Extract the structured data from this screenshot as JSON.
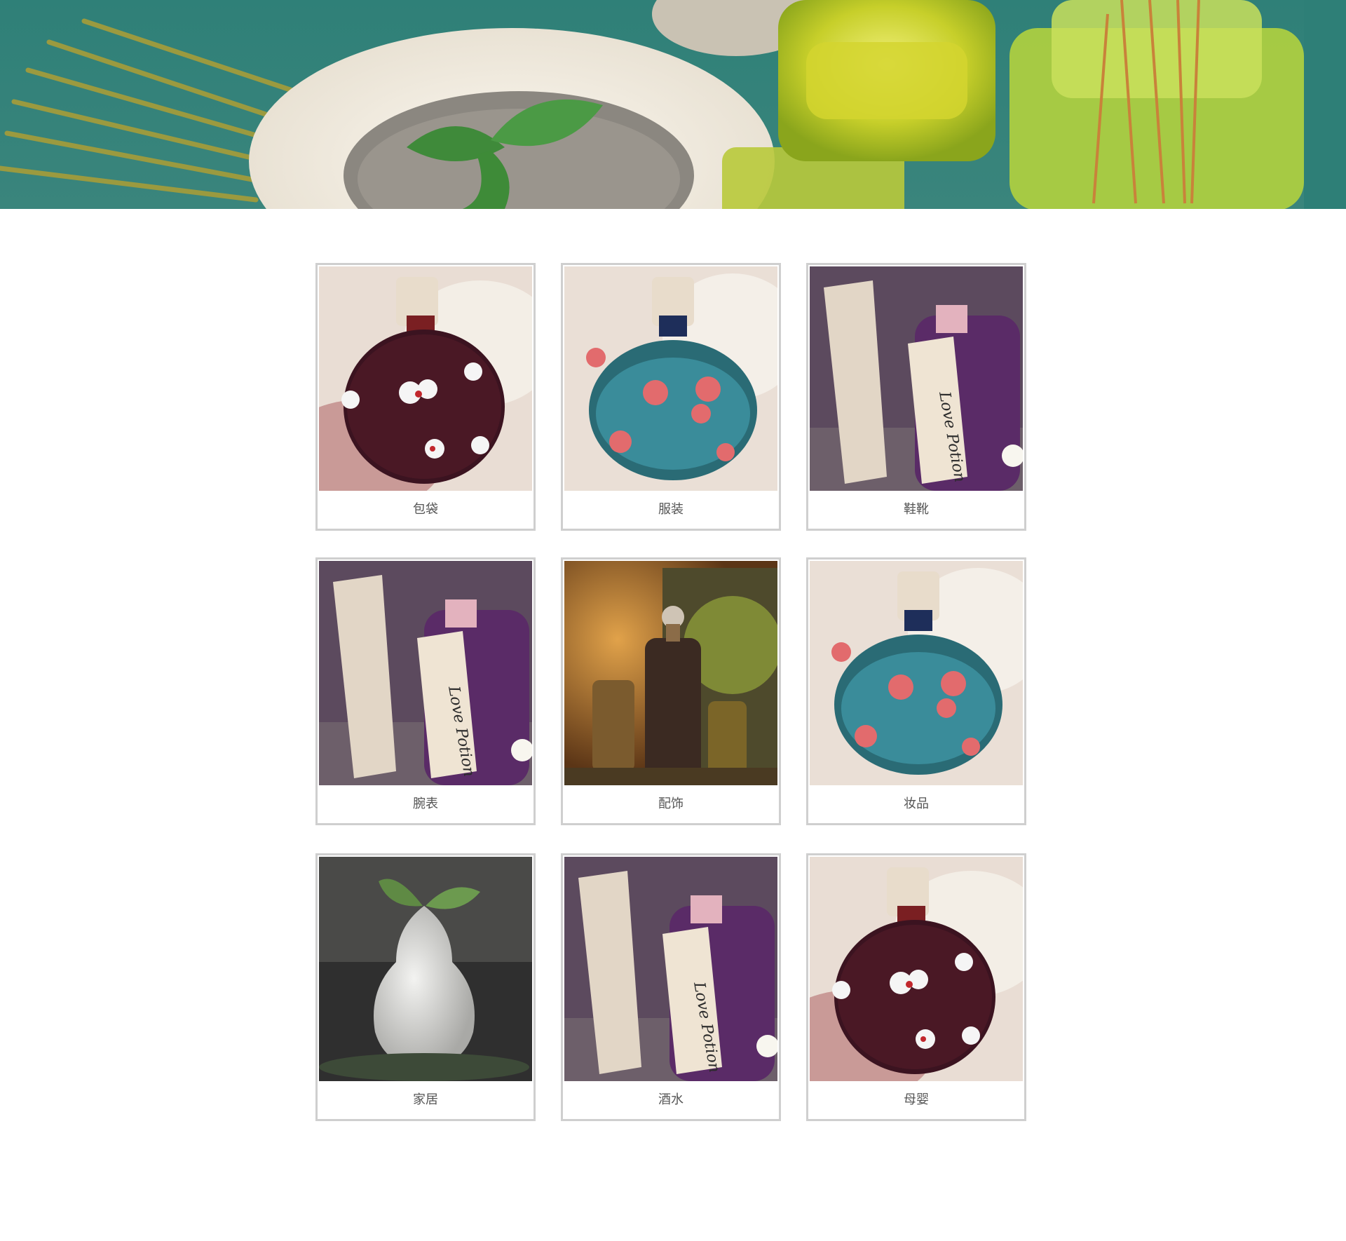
{
  "categories": [
    {
      "label": "包袋",
      "image": "flower-potion-bottle-red"
    },
    {
      "label": "服装",
      "image": "flower-potion-bottle-blue"
    },
    {
      "label": "鞋靴",
      "image": "love-potion-bottle"
    },
    {
      "label": "腕表",
      "image": "love-potion-bottle"
    },
    {
      "label": "配饰",
      "image": "essential-oil-bottles"
    },
    {
      "label": "妆品",
      "image": "flower-potion-bottle-blue"
    },
    {
      "label": "家居",
      "image": "white-pear-vase"
    },
    {
      "label": "酒水",
      "image": "love-potion-bottle"
    },
    {
      "label": "母婴",
      "image": "flower-potion-bottle-red"
    }
  ],
  "colors": {
    "card_border": "#cfcfcf",
    "label_text": "#555555",
    "background": "#ffffff"
  }
}
